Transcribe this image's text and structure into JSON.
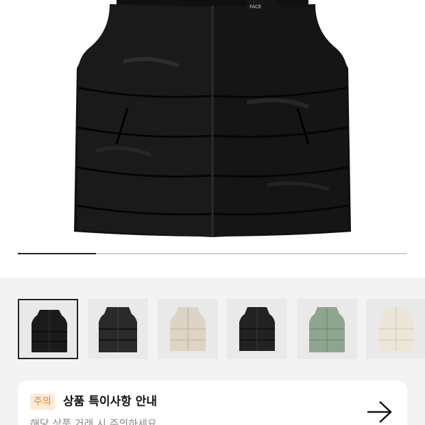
{
  "product_image": {
    "brand_logo": "THE NORTH FACE",
    "gallery_progress": 0.2
  },
  "thumbnails": [
    {
      "name": "black-glossy",
      "color": "#1b1b1b",
      "selected": true
    },
    {
      "name": "black-matte",
      "color": "#2a2a2a",
      "selected": false
    },
    {
      "name": "beige",
      "color": "#ddd4c6",
      "selected": false
    },
    {
      "name": "black-classic",
      "color": "#222222",
      "selected": false
    },
    {
      "name": "sage-green",
      "color": "#8ea58f",
      "selected": false
    },
    {
      "name": "cream",
      "color": "#ece6d8",
      "selected": false
    }
  ],
  "notice": {
    "badge": "주의",
    "title": "상품 특이사항 안내",
    "subtitle": "해당 상품 거래 시 주의하세요",
    "arrow_icon": "arrow-right-icon"
  },
  "colors": {
    "accent": "#f07f13",
    "badge_bg": "#fdebd8",
    "page_bg": "#f3f3f4"
  }
}
